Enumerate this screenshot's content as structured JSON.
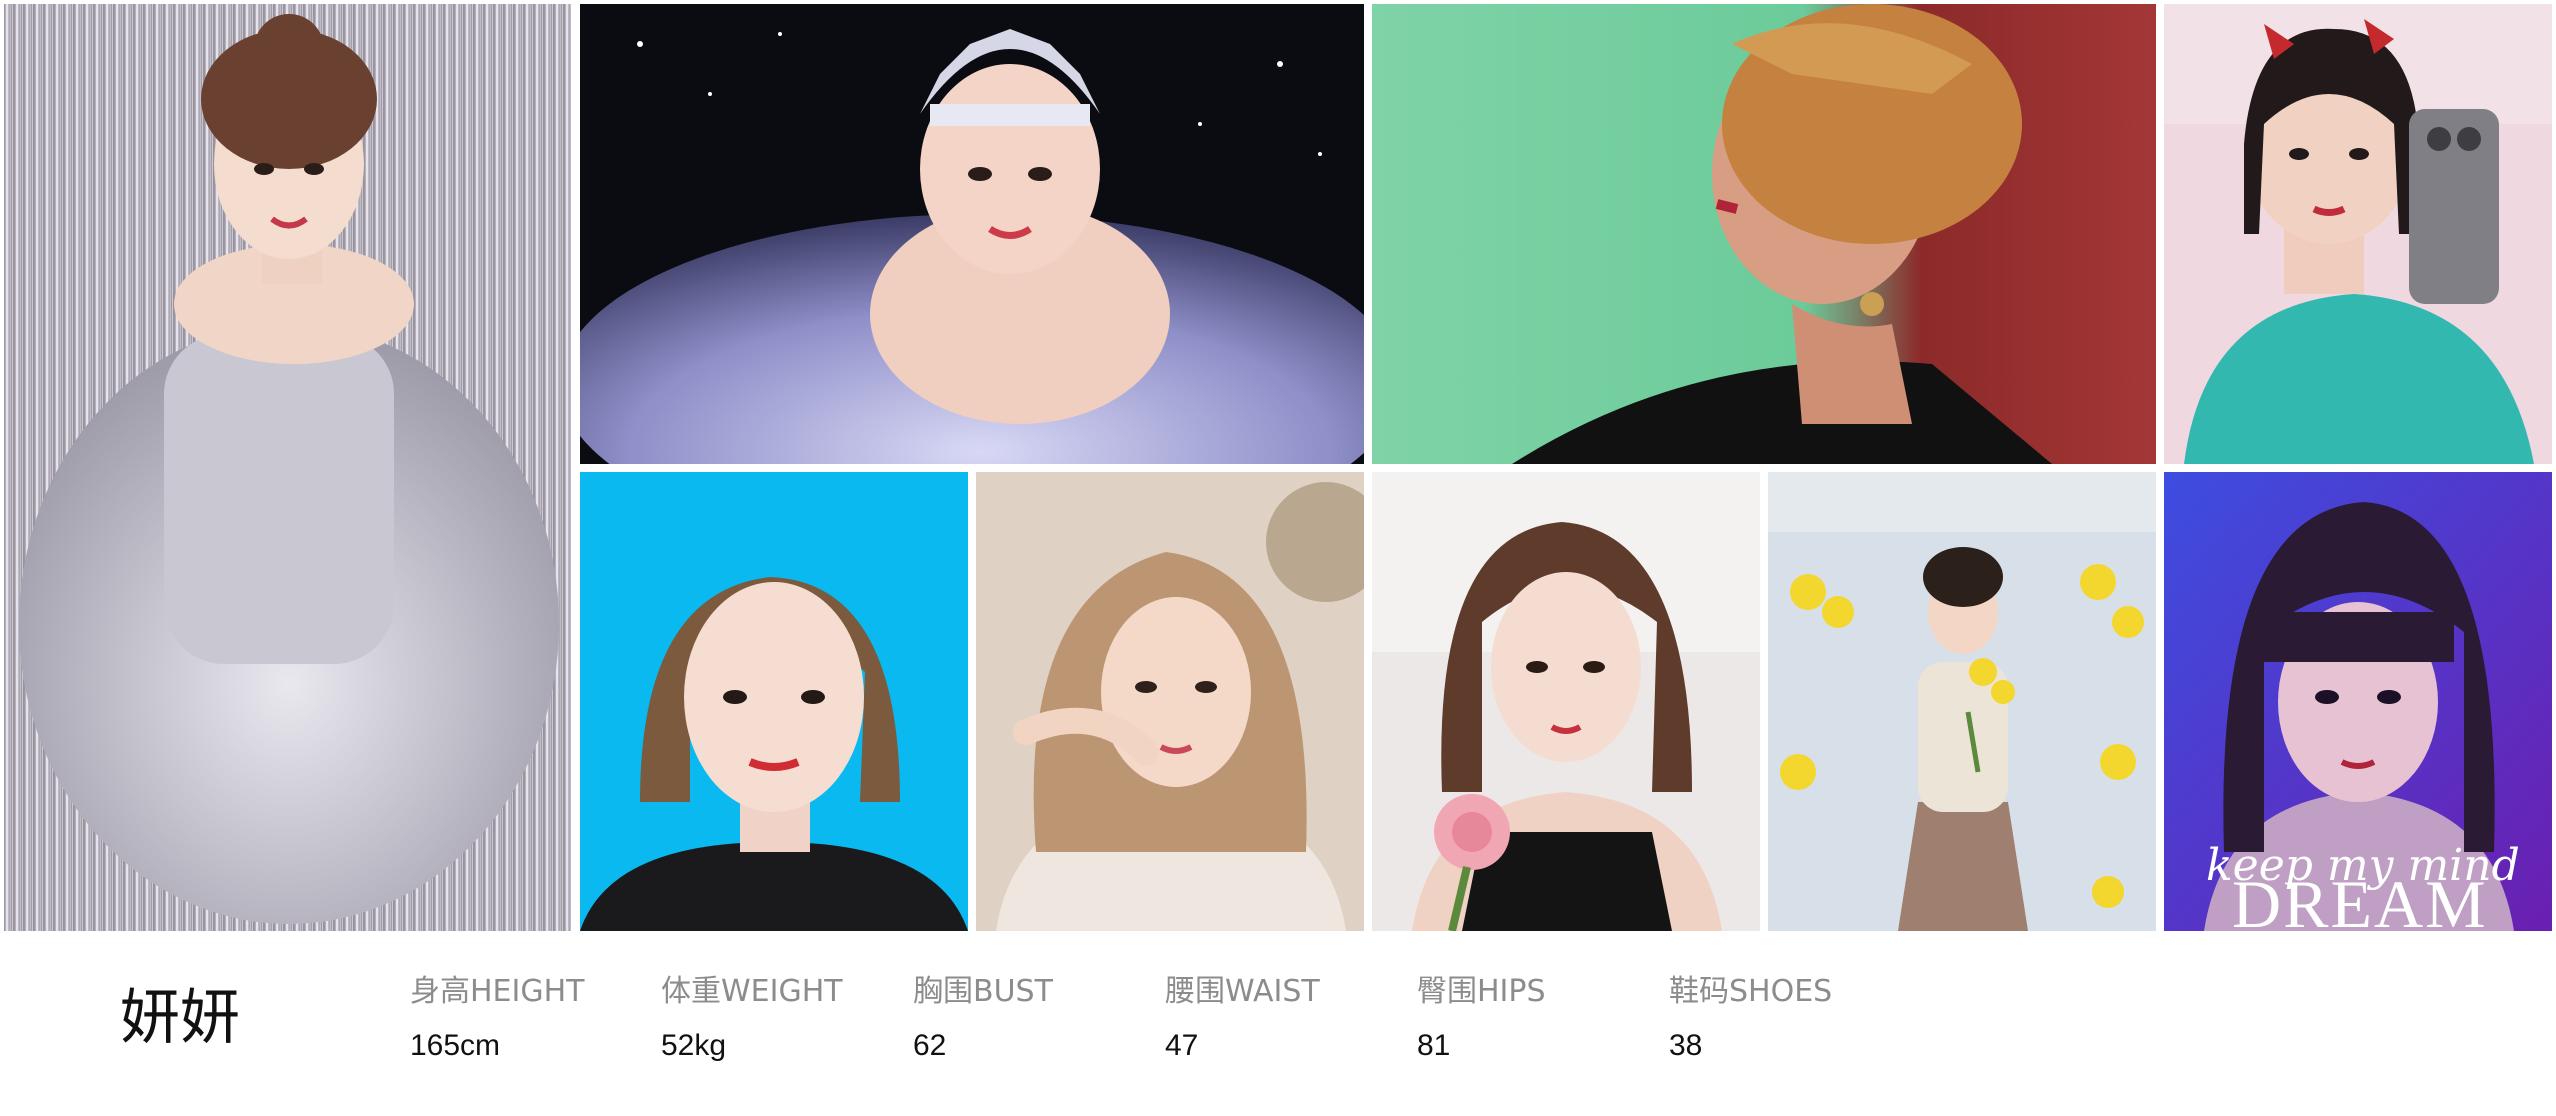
{
  "profile": {
    "name": "妍妍"
  },
  "stats": [
    {
      "label": "身高HEIGHT",
      "value": "165cm"
    },
    {
      "label": "体重WEIGHT",
      "value": "52kg"
    },
    {
      "label": "胸围BUST",
      "value": "62"
    },
    {
      "label": "腰围WAIST",
      "value": "47"
    },
    {
      "label": "臀围HIPS",
      "value": "81"
    },
    {
      "label": "鞋码SHOES",
      "value": "38"
    }
  ],
  "photos": {
    "dream_overlay": {
      "line1": "keep my mind",
      "line2": "DREAM"
    }
  },
  "colors": {
    "background": "#ffffff",
    "label": "#8c8c8c",
    "value": "#111111"
  }
}
